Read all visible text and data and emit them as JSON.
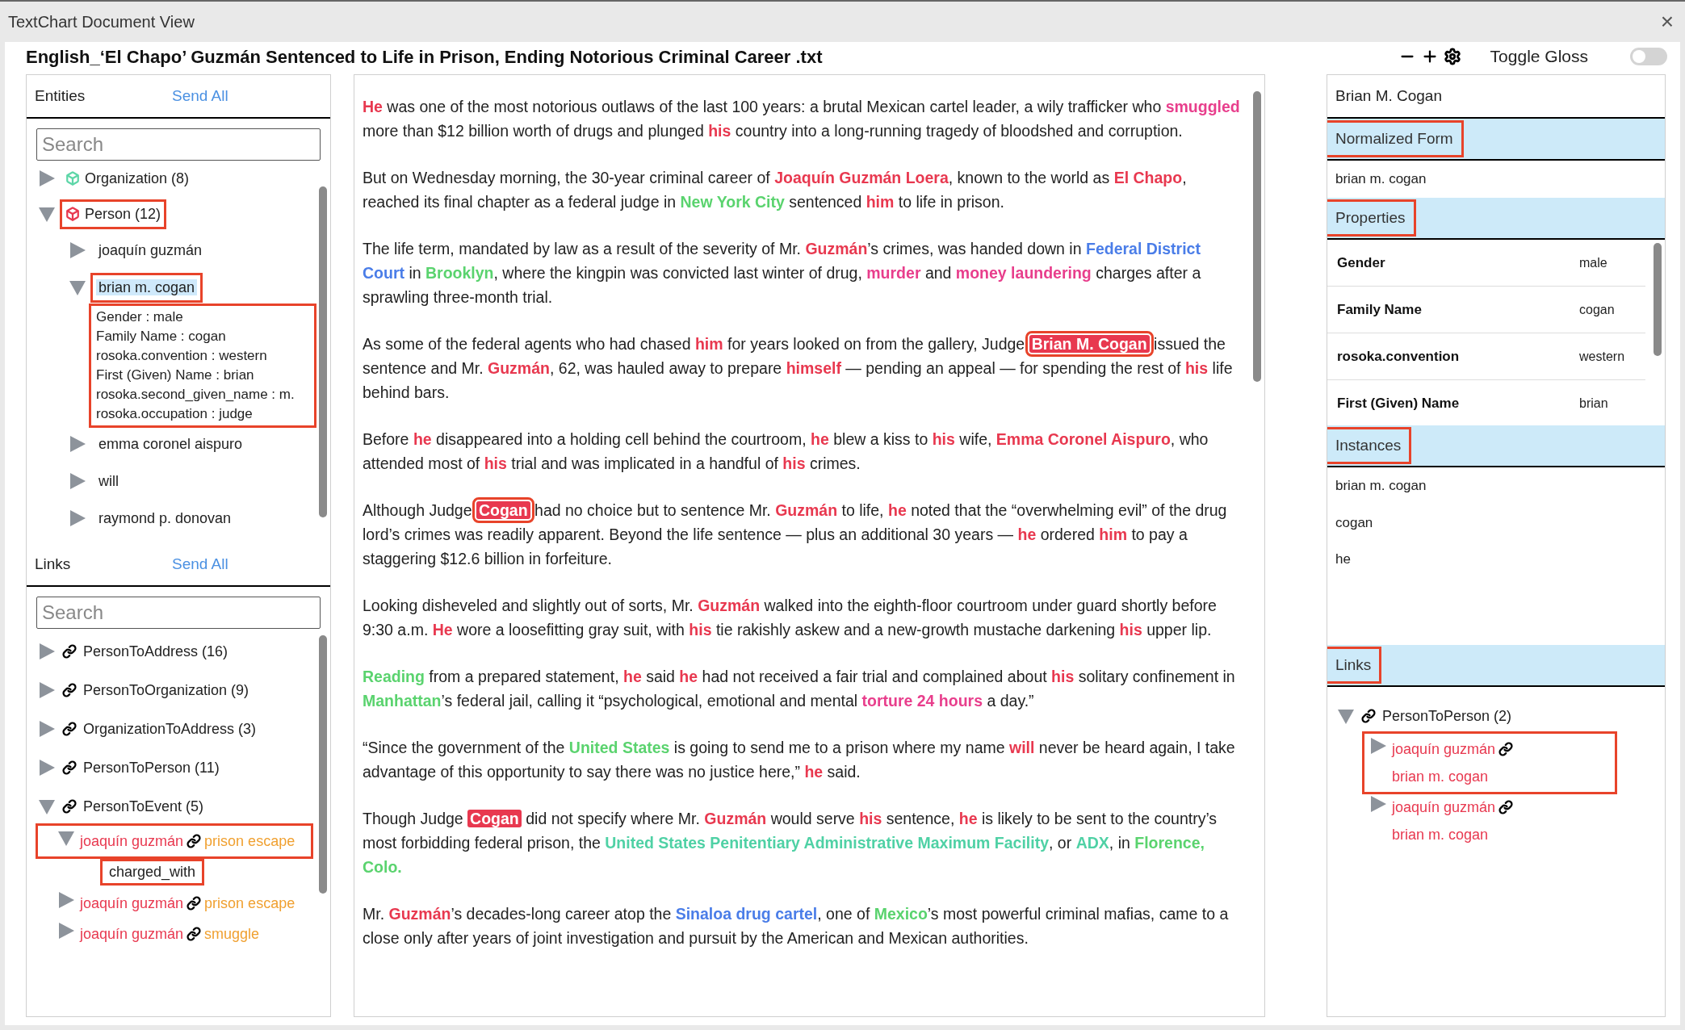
{
  "window": {
    "title": "TextChart Document View",
    "close": "×"
  },
  "document": {
    "title": "English_‘El Chapo’ Guzmán Sentenced to Life in Prison, Ending Notorious Criminal Career .txt",
    "gloss_label": "Toggle Gloss",
    "gloss_on": false
  },
  "entities": {
    "title": "Entities",
    "send_all": "Send All",
    "search": {
      "placeholder": "Search"
    },
    "tree": [
      {
        "label": "Organization (8)",
        "color": "#5ed6a8",
        "expanded": false,
        "annotated": false
      },
      {
        "label": "Person (12)",
        "color": "#e8384f",
        "expanded": true,
        "annotated": true,
        "children": [
          {
            "label": "joaquín guzmán",
            "expanded": false,
            "selected": false,
            "annotated": false
          },
          {
            "label": "brian m. cogan",
            "expanded": true,
            "selected": true,
            "annotated": true,
            "properties_annotated": true,
            "properties": [
              "Gender : male",
              "Family Name : cogan",
              "rosoka.convention : western",
              "First (Given) Name : brian",
              "rosoka.second_given_name : m.",
              "rosoka.occupation : judge"
            ]
          },
          {
            "label": "emma coronel aispuro",
            "expanded": false,
            "selected": false,
            "annotated": false
          },
          {
            "label": "will",
            "expanded": false,
            "selected": false,
            "annotated": false
          },
          {
            "label": "raymond p. donovan",
            "expanded": false,
            "selected": false,
            "annotated": false
          }
        ]
      }
    ]
  },
  "links": {
    "title": "Links",
    "send_all": "Send All",
    "search": {
      "placeholder": "Search"
    },
    "tree": [
      {
        "label": "PersonToAddress (16)",
        "expanded": false
      },
      {
        "label": "PersonToOrganization (9)",
        "expanded": false
      },
      {
        "label": "OrganizationToAddress (3)",
        "expanded": false
      },
      {
        "label": "PersonToPerson (11)",
        "expanded": false
      },
      {
        "label": "PersonToEvent (5)",
        "expanded": true,
        "children": [
          {
            "source": "joaquín guzmán",
            "target": "prison escape",
            "color": "#f0a030",
            "expanded": true,
            "annotated": true,
            "relation": "charged_with",
            "relation_annotated": true
          },
          {
            "source": "joaquín guzmán",
            "target": "prison escape",
            "color": "#f0a030",
            "expanded": false,
            "annotated": false
          },
          {
            "source": "joaquín guzmán",
            "target": "smuggle",
            "color": "#f0a030",
            "expanded": false,
            "annotated": false
          }
        ]
      }
    ]
  },
  "article": [
    [
      {
        "kind": "person",
        "text": "He"
      },
      {
        "kind": "plain",
        "text": " was one of the most notorious outlaws of the last 100 years: a brutal Mexican cartel leader, a wily trafficker who "
      },
      {
        "kind": "event",
        "text": "smuggled"
      },
      {
        "kind": "plain",
        "text": " more than $12 billion worth of drugs and plunged "
      },
      {
        "kind": "person",
        "text": "his"
      },
      {
        "kind": "plain",
        "text": " country into a long-running tragedy of bloodshed and corruption."
      }
    ],
    [
      {
        "kind": "plain",
        "text": "But on Wednesday morning, the 30-year criminal career of "
      },
      {
        "kind": "person",
        "text": "Joaquín Guzmán Loera"
      },
      {
        "kind": "plain",
        "text": ", known to the world as "
      },
      {
        "kind": "person",
        "text": "El Chapo"
      },
      {
        "kind": "plain",
        "text": ", reached its final chapter as a federal judge in "
      },
      {
        "kind": "location",
        "text": "New York City"
      },
      {
        "kind": "plain",
        "text": " sentenced "
      },
      {
        "kind": "person",
        "text": "him"
      },
      {
        "kind": "plain",
        "text": " to life in prison."
      }
    ],
    [
      {
        "kind": "plain",
        "text": "The life term, mandated by law as a result of the severity of Mr. "
      },
      {
        "kind": "person",
        "text": "Guzmán"
      },
      {
        "kind": "plain",
        "text": "’s crimes, was handed down in "
      },
      {
        "kind": "organization",
        "text": "Federal District Court"
      },
      {
        "kind": "plain",
        "text": " in "
      },
      {
        "kind": "location",
        "text": "Brooklyn"
      },
      {
        "kind": "plain",
        "text": ", where the kingpin was convicted last winter of drug, "
      },
      {
        "kind": "event",
        "text": "murder"
      },
      {
        "kind": "plain",
        "text": " and "
      },
      {
        "kind": "event",
        "text": "money laundering"
      },
      {
        "kind": "plain",
        "text": " charges after a sprawling three-month trial."
      }
    ],
    [
      {
        "kind": "plain",
        "text": "As some of the federal agents who had chased "
      },
      {
        "kind": "person",
        "text": "him"
      },
      {
        "kind": "plain",
        "text": " for years looked on from the gallery, Judge "
      },
      {
        "kind": "instance",
        "text": "Brian M. Cogan",
        "annotated": true
      },
      {
        "kind": "plain",
        "text": " issued the sentence and Mr. "
      },
      {
        "kind": "person",
        "text": "Guzmán"
      },
      {
        "kind": "plain",
        "text": ", 62, was hauled away to prepare "
      },
      {
        "kind": "person",
        "text": "himself"
      },
      {
        "kind": "plain",
        "text": " — pending an appeal — for spending the rest of "
      },
      {
        "kind": "person",
        "text": "his"
      },
      {
        "kind": "plain",
        "text": " life behind bars."
      }
    ],
    [
      {
        "kind": "plain",
        "text": "Before "
      },
      {
        "kind": "person",
        "text": "he"
      },
      {
        "kind": "plain",
        "text": " disappeared into a holding cell behind the courtroom, "
      },
      {
        "kind": "person",
        "text": "he"
      },
      {
        "kind": "plain",
        "text": " blew a kiss to "
      },
      {
        "kind": "person",
        "text": "his"
      },
      {
        "kind": "plain",
        "text": " wife, "
      },
      {
        "kind": "person",
        "text": "Emma Coronel Aispuro"
      },
      {
        "kind": "plain",
        "text": ", who attended most of "
      },
      {
        "kind": "person",
        "text": "his"
      },
      {
        "kind": "plain",
        "text": " trial and was implicated in a handful of "
      },
      {
        "kind": "person",
        "text": "his"
      },
      {
        "kind": "plain",
        "text": " crimes."
      }
    ],
    [
      {
        "kind": "plain",
        "text": "Although Judge "
      },
      {
        "kind": "instance",
        "text": "Cogan",
        "annotated": true
      },
      {
        "kind": "plain",
        "text": " had no choice but to sentence Mr. "
      },
      {
        "kind": "person",
        "text": "Guzmán"
      },
      {
        "kind": "plain",
        "text": " to life, "
      },
      {
        "kind": "person",
        "text": "he"
      },
      {
        "kind": "plain",
        "text": " noted that the “overwhelming evil” of the drug lord’s crimes was readily apparent. Beyond the life sentence — plus an additional 30 years — "
      },
      {
        "kind": "person",
        "text": "he"
      },
      {
        "kind": "plain",
        "text": " ordered "
      },
      {
        "kind": "person",
        "text": "him"
      },
      {
        "kind": "plain",
        "text": " to pay a staggering $12.6 billion in forfeiture."
      }
    ],
    [
      {
        "kind": "plain",
        "text": "Looking disheveled and slightly out of sorts, Mr. "
      },
      {
        "kind": "person",
        "text": "Guzmán"
      },
      {
        "kind": "plain",
        "text": " walked into the eighth-floor courtroom under guard shortly before 9:30 a.m. "
      },
      {
        "kind": "person",
        "text": "He"
      },
      {
        "kind": "plain",
        "text": " wore a loosefitting gray suit, with "
      },
      {
        "kind": "person",
        "text": "his"
      },
      {
        "kind": "plain",
        "text": " tie rakishly askew and a new-growth mustache darkening "
      },
      {
        "kind": "person",
        "text": "his"
      },
      {
        "kind": "plain",
        "text": " upper lip."
      }
    ],
    [
      {
        "kind": "location",
        "text": "Reading"
      },
      {
        "kind": "plain",
        "text": " from a prepared statement, "
      },
      {
        "kind": "person",
        "text": "he"
      },
      {
        "kind": "plain",
        "text": " said "
      },
      {
        "kind": "person",
        "text": "he"
      },
      {
        "kind": "plain",
        "text": " had not received a fair trial and complained about "
      },
      {
        "kind": "person",
        "text": "his"
      },
      {
        "kind": "plain",
        "text": " solitary confinement in "
      },
      {
        "kind": "location",
        "text": "Manhattan"
      },
      {
        "kind": "plain",
        "text": "’s federal jail, calling it “psychological, emotional and mental "
      },
      {
        "kind": "event",
        "text": "torture 24 hours"
      },
      {
        "kind": "plain",
        "text": " a day.”"
      }
    ],
    [
      {
        "kind": "plain",
        "text": "“Since the government of the "
      },
      {
        "kind": "location",
        "text": "United States"
      },
      {
        "kind": "plain",
        "text": " is going to send me to a prison where my name "
      },
      {
        "kind": "person",
        "text": "will"
      },
      {
        "kind": "plain",
        "text": " never be heard again, I take advantage of this opportunity to say there was no justice here,” "
      },
      {
        "kind": "person",
        "text": "he"
      },
      {
        "kind": "plain",
        "text": " said."
      }
    ],
    [
      {
        "kind": "plain",
        "text": "Though Judge "
      },
      {
        "kind": "instance",
        "text": "Cogan",
        "annotated": false
      },
      {
        "kind": "plain",
        "text": " did not specify where Mr. "
      },
      {
        "kind": "person",
        "text": "Guzmán"
      },
      {
        "kind": "plain",
        "text": " would serve "
      },
      {
        "kind": "person",
        "text": "his"
      },
      {
        "kind": "plain",
        "text": " sentence, "
      },
      {
        "kind": "person",
        "text": "he"
      },
      {
        "kind": "plain",
        "text": " is likely to be sent to the country’s most forbidding federal prison, the "
      },
      {
        "kind": "facility",
        "text": "United States Penitentiary Administrative Maximum Facility"
      },
      {
        "kind": "plain",
        "text": ", or "
      },
      {
        "kind": "facility",
        "text": "ADX"
      },
      {
        "kind": "plain",
        "text": ", in "
      },
      {
        "kind": "location",
        "text": "Florence, Colo."
      }
    ],
    [
      {
        "kind": "plain",
        "text": "Mr. "
      },
      {
        "kind": "person",
        "text": "Guzmán"
      },
      {
        "kind": "plain",
        "text": "’s decades-long career atop the "
      },
      {
        "kind": "organization",
        "text": "Sinaloa drug cartel"
      },
      {
        "kind": "plain",
        "text": ", one of "
      },
      {
        "kind": "location",
        "text": "Mexico"
      },
      {
        "kind": "plain",
        "text": "’s most powerful criminal mafias, came to a close only after years of joint investigation and pursuit by the American and Mexican authorities."
      }
    ]
  ],
  "details": {
    "name": "Brian M. Cogan",
    "normalized": {
      "title": "Normalized Form",
      "annotated": true,
      "value": "brian m. cogan"
    },
    "properties": {
      "title": "Properties",
      "annotated": true,
      "rows": [
        {
          "name": "Gender",
          "value": "male"
        },
        {
          "name": "Family Name",
          "value": "cogan"
        },
        {
          "name": "rosoka.convention",
          "value": "western"
        },
        {
          "name": "First (Given) Name",
          "value": "brian"
        }
      ]
    },
    "instances": {
      "title": "Instances",
      "annotated": true,
      "items": [
        "brian m. cogan",
        "cogan",
        "he"
      ]
    },
    "links": {
      "title": "Links",
      "annotated": true,
      "tree": [
        {
          "label": "PersonToPerson (2)",
          "expanded": true,
          "children": [
            {
              "source": "joaquín guzmán",
              "target": "brian m. cogan",
              "color": "#e8384f",
              "expanded": false,
              "annotated": true
            },
            {
              "source": "joaquín guzmán",
              "target": "brian m. cogan",
              "color": "#e8384f",
              "expanded": false,
              "annotated": false
            }
          ]
        }
      ]
    }
  }
}
